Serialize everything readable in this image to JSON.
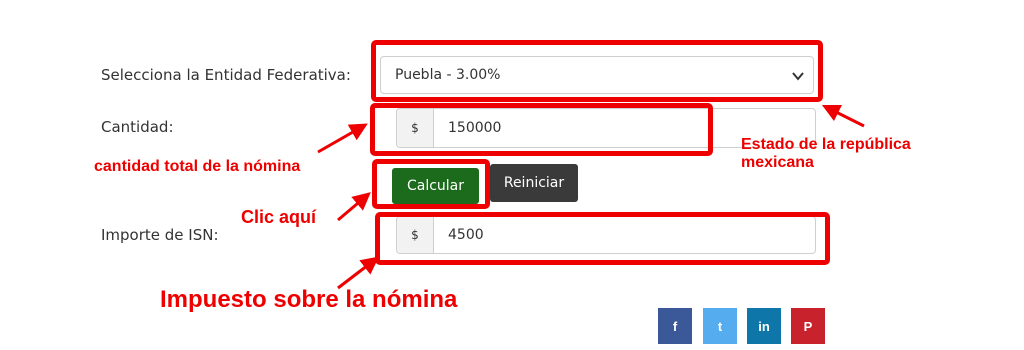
{
  "form": {
    "state_label": "Selecciona la Entidad Federativa:",
    "state_value": "Puebla - 3.00%",
    "amount_label": "Cantidad:",
    "amount_prefix": "$",
    "amount_value": "150000",
    "calculate_label": "Calcular",
    "reset_label": "Reiniciar",
    "isn_label": "Importe de ISN:",
    "isn_prefix": "$",
    "isn_value": "4500"
  },
  "annotations": {
    "state_note_line1": "Estado de la república",
    "state_note_line2": "mexicana",
    "amount_note": "cantidad total de la nómina",
    "click_note": "Clic aquí",
    "tax_note": "Impuesto sobre la nómina",
    "color": "#ee0000"
  },
  "social": {
    "facebook": {
      "icon": "facebook-icon",
      "glyph": "f",
      "color": "#3b5998"
    },
    "twitter": {
      "icon": "twitter-icon",
      "glyph": "t",
      "color": "#55acee"
    },
    "linkedin": {
      "icon": "linkedin-icon",
      "glyph": "in",
      "color": "#0e76a8"
    },
    "pinterest": {
      "icon": "pinterest-icon",
      "glyph": "P",
      "color": "#c8232c"
    }
  }
}
